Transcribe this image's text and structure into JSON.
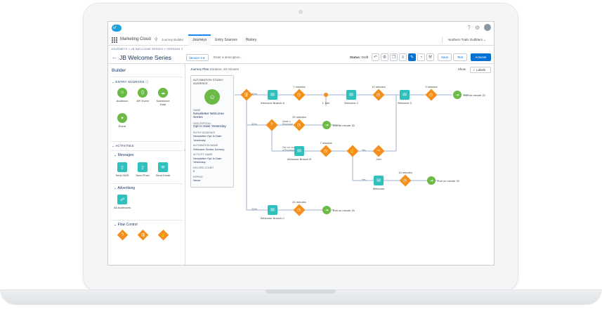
{
  "header": {
    "app_name": "Marketing Cloud",
    "sub_app": "Journey Builder",
    "tabs": [
      "Journeys",
      "Entry Sources",
      "History"
    ],
    "business_unit": "Northern Trails Outfitters",
    "help": "?",
    "logo_text": "sf"
  },
  "breadcrumb": "JOURNEYS » JB WELCOME SERIES » VERSION 3",
  "journey": {
    "title": "JB Welcome Series",
    "version": "Version 3",
    "description_placeholder": "Enter a description...",
    "status_label": "Status:",
    "status_value": "Draft",
    "save": "Save",
    "test": "Test",
    "activate": "Activate"
  },
  "builder": {
    "title": "Builder",
    "entry_sources_heading": "ENTRY SOURCES",
    "entry_sources": [
      "Audience",
      "API Event",
      "Salesforce Data",
      "Event"
    ],
    "activities_heading": "ACTIVITIES",
    "messages_heading": "Messages",
    "messages": [
      "Send SMS",
      "Send Push",
      "Send Email"
    ],
    "advertising_heading": "Advertising",
    "advertising": [
      "All Audiences"
    ],
    "flow_control_heading": "Flow Control"
  },
  "canvas": {
    "plan_label": "Journey Plan",
    "plan_duration": "Duration: 20 minutes",
    "show": "Show",
    "labels_toggle": "Labels"
  },
  "entry_card": {
    "title": "AUTOMATION STUDIO AUDIENCE",
    "name_k": "NAME",
    "name_v": "Newsletter Welcome Series",
    "desc_k": "DESCRIPTION",
    "desc_v": "Opt In Date Yesterday",
    "aud_k": "ENTRY AUDIENCE",
    "aud_v": "Newsletter Opt In Date Yesterday",
    "auto_k": "AUTOMATION NAME",
    "auto_v": "Welcome Series Journey",
    "act_k": "ACTIVITY NAME",
    "act_v": "Newsletter Opt In Date Yesterday",
    "rec_k": "RECORD COUNT",
    "rec_v": "0",
    "rep_k": "REPEAT",
    "rep_v": "Never"
  },
  "flow": {
    "pct_top": "40%",
    "pct_mid": "40%",
    "pct_bot": "20%",
    "welcome_branch_a": "Welcome Branch A",
    "welcome_branch_b": "Welcome Branch B",
    "welcome_branch_c": "Welcome Branch C",
    "welcome2": "Welcome 2",
    "welcome3": "Welcome 3",
    "welcome": "Welcome",
    "join1": "1 Join",
    "join": "Join",
    "made_purchase": "Made a Purchase",
    "not_purchase": "Did not make a Purchase",
    "yes": "Yes",
    "m7a": "7 minutes",
    "m10": "10 minutes",
    "m3": "3 minutes",
    "m20a": "20 minutes",
    "m7b": "7 minutes",
    "m13": "13 minutes",
    "m20b": "20 minutes",
    "exit": "Exit on minute 20"
  },
  "colors": {
    "orange": "#f38f1a",
    "teal": "#2fbfbd",
    "green": "#6bba46",
    "blue": "#0070d2",
    "line": "#9fb2cc"
  }
}
